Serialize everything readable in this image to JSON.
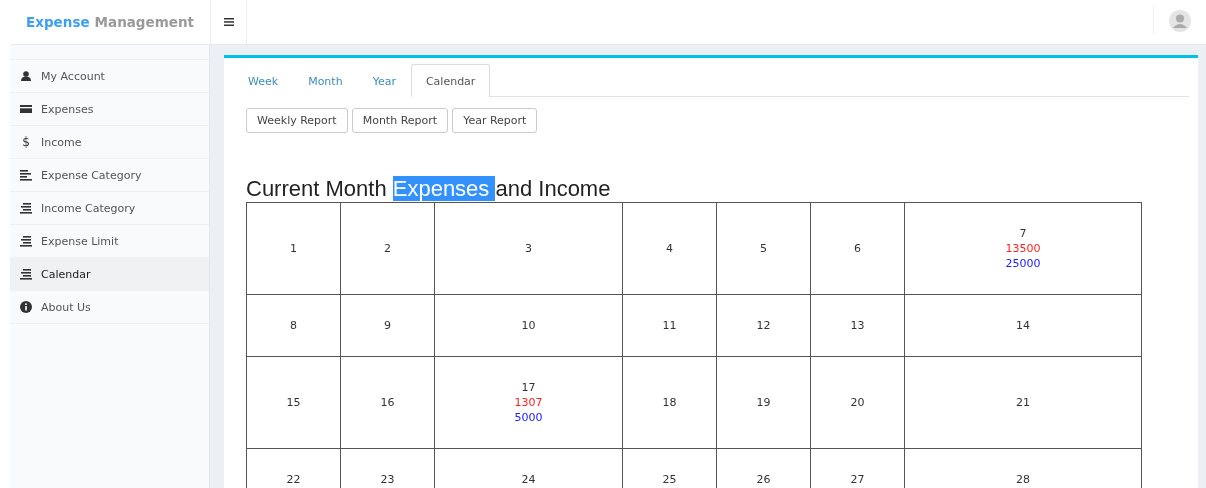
{
  "brand": {
    "first": "Expense",
    "second": "Management"
  },
  "sidebar": {
    "items": [
      {
        "label": "My Account",
        "kind": "user",
        "selected": false
      },
      {
        "label": "Expenses",
        "kind": "card",
        "selected": false
      },
      {
        "label": "Income",
        "kind": "glyph",
        "glyph": "$",
        "selected": false
      },
      {
        "label": "Expense Category",
        "kind": "align",
        "selected": false
      },
      {
        "label": "Income Category",
        "kind": "stack",
        "selected": false
      },
      {
        "label": "Expense Limit",
        "kind": "stack",
        "selected": false
      },
      {
        "label": "Calendar",
        "kind": "stack",
        "selected": true
      },
      {
        "label": "About Us",
        "kind": "info",
        "selected": false
      }
    ]
  },
  "tabs": [
    {
      "label": "Week",
      "selected": false
    },
    {
      "label": "Month",
      "selected": false
    },
    {
      "label": "Year",
      "selected": false
    },
    {
      "label": "Calendar",
      "selected": true
    }
  ],
  "buttons": [
    "Weekly Report",
    "Month Report",
    "Year Report"
  ],
  "heading": {
    "parts": [
      {
        "text": "Current Month ",
        "selected": false
      },
      {
        "text": "Expenses ",
        "selected": true
      },
      {
        "text": "and Income",
        "selected": false
      }
    ]
  },
  "calendar": {
    "weeks": [
      [
        {
          "day": "1"
        },
        {
          "day": "2"
        },
        {
          "day": "3"
        },
        {
          "day": "4"
        },
        {
          "day": "5"
        },
        {
          "day": "6"
        },
        {
          "day": "7",
          "expense": "13500",
          "income": "25000"
        }
      ],
      [
        {
          "day": "8"
        },
        {
          "day": "9"
        },
        {
          "day": "10"
        },
        {
          "day": "11"
        },
        {
          "day": "12"
        },
        {
          "day": "13"
        },
        {
          "day": "14"
        }
      ],
      [
        {
          "day": "15"
        },
        {
          "day": "16"
        },
        {
          "day": "17",
          "expense": "1307",
          "income": "5000"
        },
        {
          "day": "18"
        },
        {
          "day": "19"
        },
        {
          "day": "20"
        },
        {
          "day": "21"
        }
      ],
      [
        {
          "day": "22"
        },
        {
          "day": "23"
        },
        {
          "day": "24"
        },
        {
          "day": "25"
        },
        {
          "day": "26"
        },
        {
          "day": "27"
        },
        {
          "day": "28"
        }
      ]
    ]
  }
}
